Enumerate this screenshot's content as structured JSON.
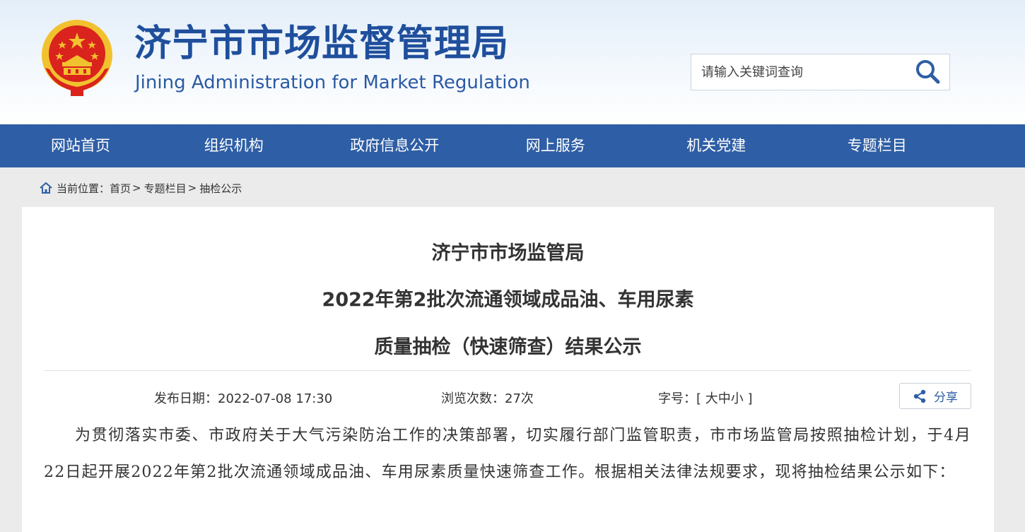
{
  "header": {
    "title_cn": "济宁市市场监督管理局",
    "title_en": "Jining Administration for Market Regulation",
    "emblem_icon": "national-emblem-icon"
  },
  "search": {
    "placeholder": "请输入关键词查询",
    "icon": "search-icon"
  },
  "nav": {
    "items": [
      "网站首页",
      "组织机构",
      "政府信息公开",
      "网上服务",
      "机关党建",
      "专题栏目"
    ]
  },
  "breadcrumb": {
    "label": "当前位置：",
    "items": [
      "首页",
      "专题栏目",
      "抽检公示"
    ],
    "sep": ">"
  },
  "article": {
    "title_lines": [
      "济宁市市场监管局",
      "2022年第2批次流通领域成品油、车用尿素",
      "质量抽检（快速筛查）结果公示"
    ],
    "publish_label": "发布日期：",
    "publish_date": "2022-07-08 17:30",
    "views_label": "浏览次数：",
    "views": "27次",
    "font_label": "字号：",
    "font_options": "[ 大中小 ]",
    "share_label": "分享",
    "body": "为贯彻落实市委、市政府关于大气污染防治工作的决策部署，切实履行部门监管职责，市市场监管局按照抽检计划，于4月22日起开展2022年第2批次流通领域成品油、车用尿素质量快速筛查工作。根据相关法律法规要求，现将抽检结果公示如下："
  },
  "colors": {
    "brand_blue": "#2e5ea5",
    "title_blue": "#1f4f9c",
    "emblem_red": "#d9231c",
    "emblem_gold": "#f2c12e"
  }
}
